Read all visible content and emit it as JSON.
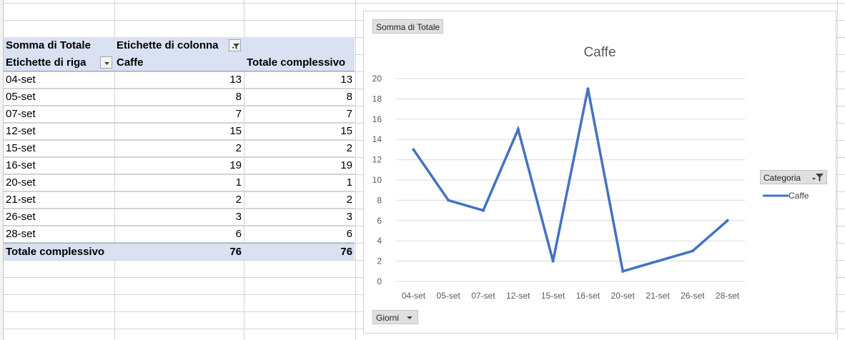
{
  "pivot": {
    "header1": {
      "measure": "Somma di Totale",
      "col_labels": "Etichette di colonna"
    },
    "header2": {
      "row_labels": "Etichette di riga",
      "col1": "Caffe",
      "col2": "Totale complessivo"
    },
    "rows": [
      {
        "label": "04-set",
        "caffe": "13",
        "total": "13"
      },
      {
        "label": "05-set",
        "caffe": "8",
        "total": "8"
      },
      {
        "label": "07-set",
        "caffe": "7",
        "total": "7"
      },
      {
        "label": "12-set",
        "caffe": "15",
        "total": "15"
      },
      {
        "label": "15-set",
        "caffe": "2",
        "total": "2"
      },
      {
        "label": "16-set",
        "caffe": "19",
        "total": "19"
      },
      {
        "label": "20-set",
        "caffe": "1",
        "total": "1"
      },
      {
        "label": "21-set",
        "caffe": "2",
        "total": "2"
      },
      {
        "label": "26-set",
        "caffe": "3",
        "total": "3"
      },
      {
        "label": "28-set",
        "caffe": "6",
        "total": "6"
      }
    ],
    "grand_total": {
      "label": "Totale complessivo",
      "caffe": "76",
      "total": "76"
    }
  },
  "chart_buttons": {
    "value_field": "Somma di Totale",
    "axis_field": "Giorni",
    "legend_field": "Categoria"
  },
  "chart_data": {
    "type": "line",
    "title": "Caffe",
    "categories": [
      "04-set",
      "05-set",
      "07-set",
      "12-set",
      "15-set",
      "16-set",
      "20-set",
      "21-set",
      "26-set",
      "28-set"
    ],
    "series": [
      {
        "name": "Caffe",
        "values": [
          13,
          8,
          7,
          15,
          2,
          19,
          1,
          2,
          3,
          6
        ],
        "color": "#4472c4"
      }
    ],
    "ylim": [
      0,
      20
    ],
    "yticks": [
      0,
      2,
      4,
      6,
      8,
      10,
      12,
      14,
      16,
      18,
      20
    ],
    "grid": true,
    "legend": "right"
  }
}
